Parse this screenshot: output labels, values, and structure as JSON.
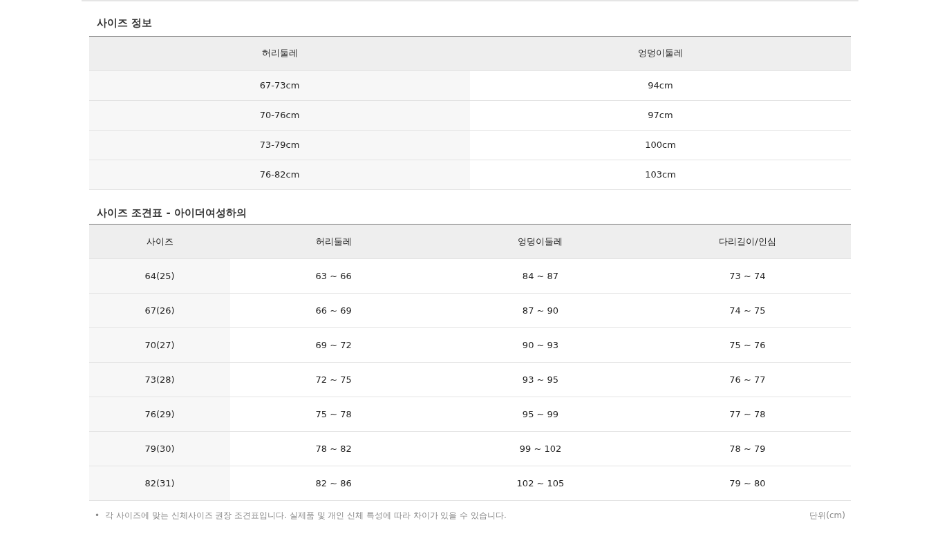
{
  "size_info": {
    "title": "사이즈 정보",
    "columns": [
      "허리둘레",
      "엉덩이둘레"
    ],
    "rows": [
      [
        "67-73cm",
        "94cm"
      ],
      [
        "70-76cm",
        "97cm"
      ],
      [
        "73-79cm",
        "100cm"
      ],
      [
        "76-82cm",
        "103cm"
      ]
    ]
  },
  "size_chart": {
    "title": "사이즈 조견표 - 아이더여성하의",
    "columns": [
      "사이즈",
      "허리둘레",
      "엉덩이둘레",
      "다리길이/인심"
    ],
    "rows": [
      [
        "64(25)",
        "63 ~ 66",
        "84 ~ 87",
        "73 ~ 74"
      ],
      [
        "67(26)",
        "66 ~ 69",
        "87 ~ 90",
        "74 ~ 75"
      ],
      [
        "70(27)",
        "69 ~ 72",
        "90 ~ 93",
        "75 ~ 76"
      ],
      [
        "73(28)",
        "72 ~ 75",
        "93 ~ 95",
        "76 ~ 77"
      ],
      [
        "76(29)",
        "75 ~ 78",
        "95 ~ 99",
        "77 ~ 78"
      ],
      [
        "79(30)",
        "78 ~ 82",
        "99 ~ 102",
        "78 ~ 79"
      ],
      [
        "82(31)",
        "82 ~ 86",
        "102 ~ 105",
        "79 ~ 80"
      ]
    ]
  },
  "footnote": {
    "bullet": "•",
    "text": "각 사이즈에 맞는 신체사이즈 권장 조견표입니다. 실제품 및 개인 신체 특성에 따라 차이가 있을 수 있습니다.",
    "unit": "단위(cm)"
  }
}
